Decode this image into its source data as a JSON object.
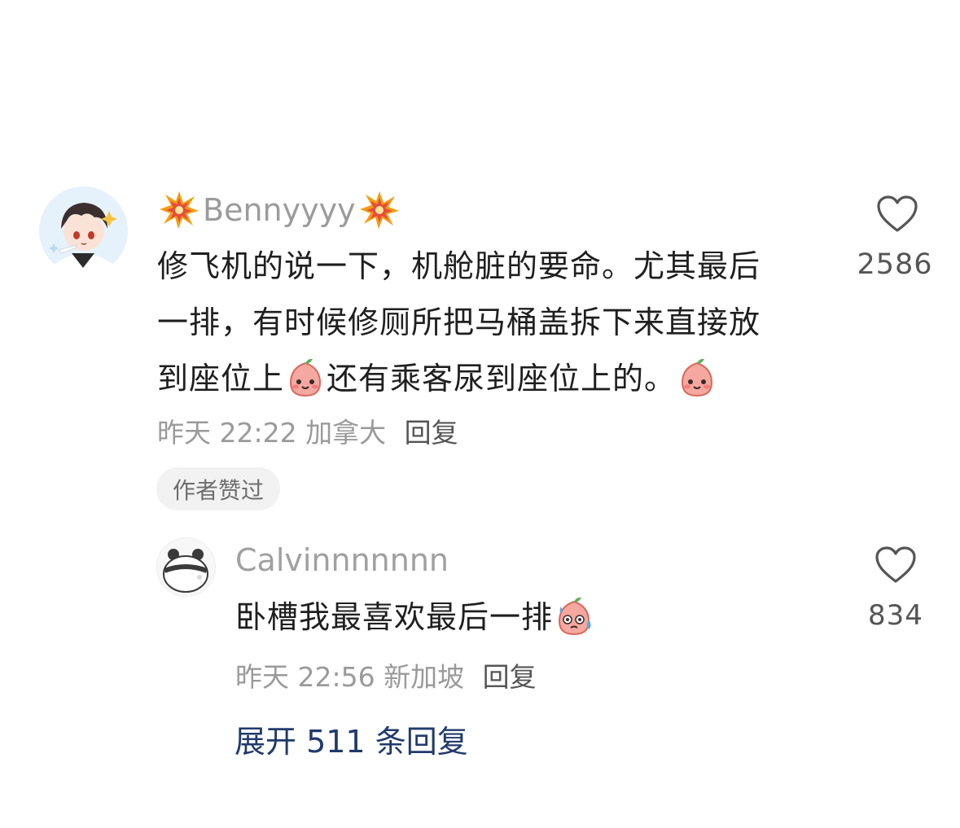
{
  "comment": {
    "username": "Benny yyyy",
    "username_display": "Bennyyyy",
    "lines": [
      "修飞机的说一下，机舱脏的要命。尤其最后",
      "一排，有时候修厕所把马桶盖拆下来直接放",
      "到座位上",
      "还有乘客尿到座位上的。"
    ],
    "time": "昨天 22:22",
    "location": "加拿大",
    "reply_label": "回复",
    "author_liked": "作者赞过",
    "likes": "2586"
  },
  "reply": {
    "username": "Calvinnnnnnn",
    "text": "卧槽我最喜欢最后一排",
    "time": "昨天 22:56",
    "location": "新加坡",
    "reply_label": "回复",
    "likes": "834"
  },
  "expand": {
    "label": "展开 511 条回复"
  },
  "icons": {
    "username_decoration": "collision-burst-icon",
    "emoji_main": "peach-smile-emoji",
    "emoji_reply": "peach-sweat-emoji",
    "like": "heart-outline-icon"
  },
  "colors": {
    "text": "#1f1f1f",
    "meta": "#9a9a9a",
    "link": "#213a6b",
    "heart": "#555555"
  }
}
